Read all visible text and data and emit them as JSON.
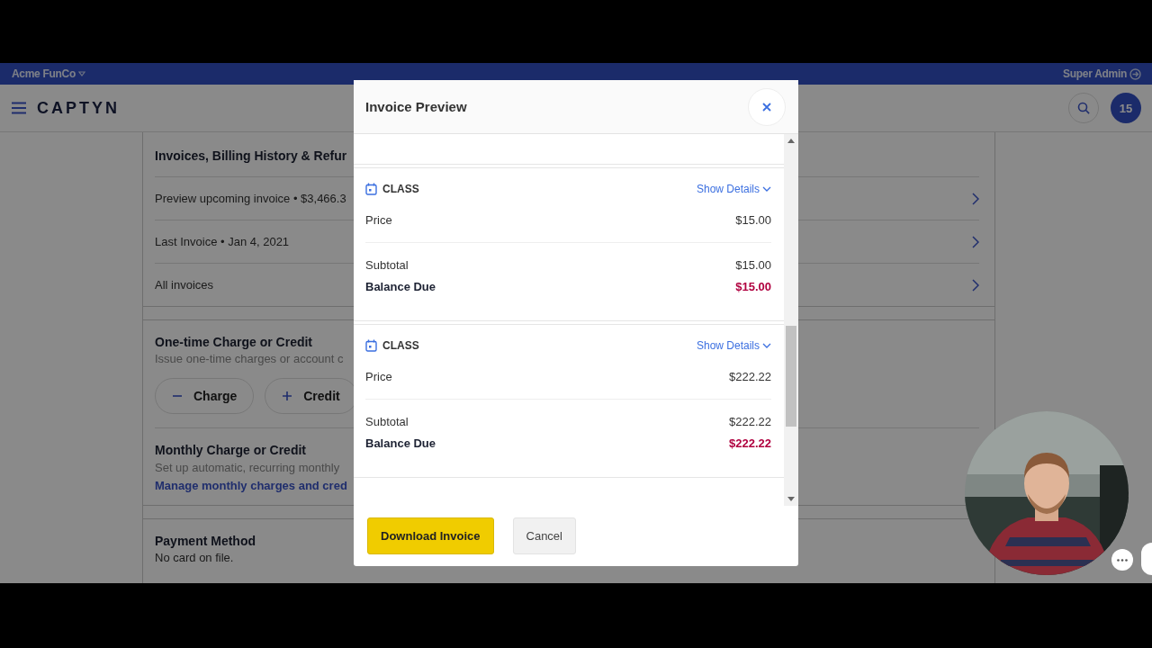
{
  "top_bar": {
    "account": "Acme FunCo",
    "user": "Super Admin"
  },
  "header": {
    "logo": "CAPTYN",
    "notification_count": "15"
  },
  "billing": {
    "title": "Invoices, Billing History & Refur",
    "rows": [
      "Preview upcoming invoice • $3,466.3",
      "Last Invoice • Jan 4, 2021",
      "All invoices"
    ]
  },
  "one_time": {
    "title": "One-time Charge or Credit",
    "description": "Issue one-time charges or account c",
    "buttons": [
      {
        "label": "Charge",
        "kind": "minus"
      },
      {
        "label": "Credit",
        "kind": "plus"
      }
    ]
  },
  "monthly": {
    "title": "Monthly Charge or Credit",
    "description": "Set up automatic, recurring monthly",
    "link": "Manage monthly charges and cred"
  },
  "payment": {
    "title": "Payment Method",
    "description": "No card on file."
  },
  "modal": {
    "title": "Invoice Preview",
    "items": [
      {
        "type_label": "CLASS",
        "details_link": "Show Details",
        "rows": [
          {
            "kind": "line",
            "label": "Price",
            "amount": "$15.00"
          },
          {
            "kind": "subtotal",
            "label": "Subtotal",
            "amount": "$15.00"
          },
          {
            "kind": "balance",
            "label": "Balance Due",
            "amount": "$15.00"
          }
        ]
      },
      {
        "type_label": "CLASS",
        "details_link": "Show Details",
        "rows": [
          {
            "kind": "line",
            "label": "Price",
            "amount": "$222.22"
          },
          {
            "kind": "subtotal",
            "label": "Subtotal",
            "amount": "$222.22"
          },
          {
            "kind": "balance",
            "label": "Balance Due",
            "amount": "$222.22"
          }
        ]
      }
    ],
    "buttons": [
      {
        "label": "Download Invoice",
        "kind": "primary"
      },
      {
        "label": "Cancel",
        "kind": "secondary"
      }
    ]
  }
}
